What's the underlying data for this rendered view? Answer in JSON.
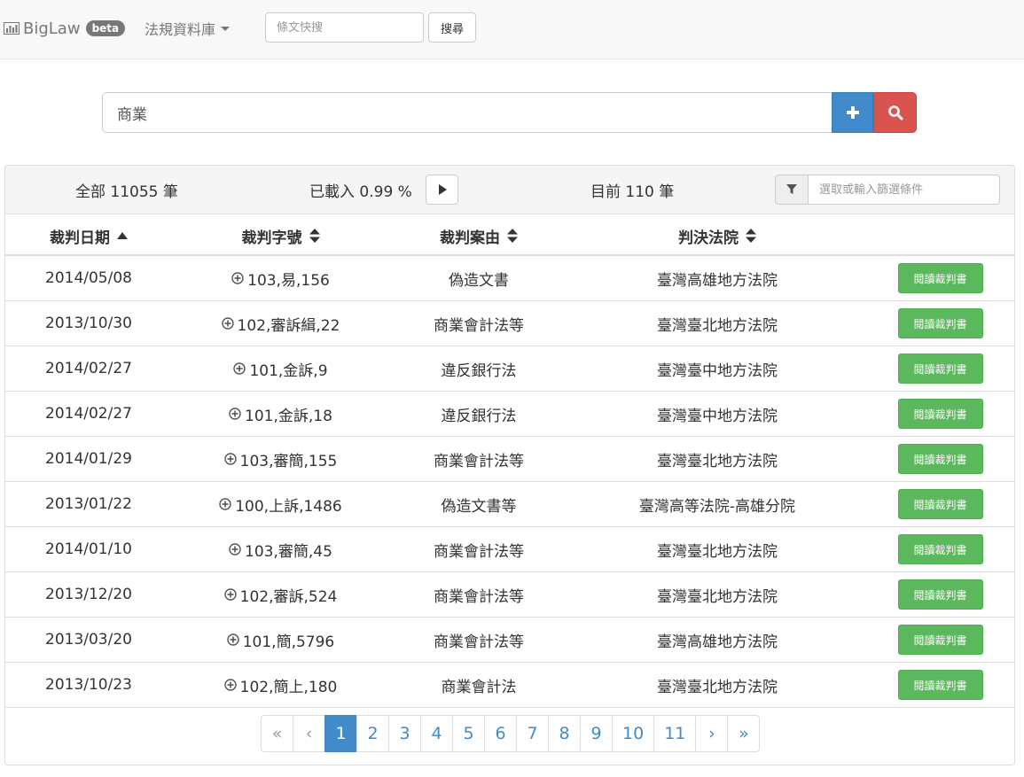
{
  "navbar": {
    "brand": "BigLaw",
    "badge": "beta",
    "dropdown_label": "法規資料庫",
    "quick_search_placeholder": "條文快搜",
    "quick_search_button": "搜尋"
  },
  "search": {
    "value": "商業"
  },
  "summary": {
    "total": "全部 11055 筆",
    "loaded": "已載入 0.99 %",
    "current": "目前 110 筆",
    "filter_placeholder": "選取或輸入篩選條件"
  },
  "table": {
    "columns": [
      {
        "label": "裁判日期",
        "sort": "asc"
      },
      {
        "label": "裁判字號",
        "sort": "both"
      },
      {
        "label": "裁判案由",
        "sort": "both"
      },
      {
        "label": "判決法院",
        "sort": "both"
      }
    ],
    "action_label": "閱讀裁判書",
    "rows": [
      {
        "date": "2014/05/08",
        "no": "103,易,156",
        "reason": "偽造文書",
        "court": "臺灣高雄地方法院"
      },
      {
        "date": "2013/10/30",
        "no": "102,審訴緝,22",
        "reason": "商業會計法等",
        "court": "臺灣臺北地方法院"
      },
      {
        "date": "2014/02/27",
        "no": "101,金訴,9",
        "reason": "違反銀行法",
        "court": "臺灣臺中地方法院"
      },
      {
        "date": "2014/02/27",
        "no": "101,金訴,18",
        "reason": "違反銀行法",
        "court": "臺灣臺中地方法院"
      },
      {
        "date": "2014/01/29",
        "no": "103,審簡,155",
        "reason": "商業會計法等",
        "court": "臺灣臺北地方法院"
      },
      {
        "date": "2013/01/22",
        "no": "100,上訴,1486",
        "reason": "偽造文書等",
        "court": "臺灣高等法院-高雄分院"
      },
      {
        "date": "2014/01/10",
        "no": "103,審簡,45",
        "reason": "商業會計法等",
        "court": "臺灣臺北地方法院"
      },
      {
        "date": "2013/12/20",
        "no": "102,審訴,524",
        "reason": "商業會計法等",
        "court": "臺灣臺北地方法院"
      },
      {
        "date": "2013/03/20",
        "no": "101,簡,5796",
        "reason": "商業會計法等",
        "court": "臺灣高雄地方法院"
      },
      {
        "date": "2013/10/23",
        "no": "102,簡上,180",
        "reason": "商業會計法",
        "court": "臺灣臺北地方法院"
      }
    ]
  },
  "pagination": {
    "first": "«",
    "prev": "‹",
    "pages": [
      "1",
      "2",
      "3",
      "4",
      "5",
      "6",
      "7",
      "8",
      "9",
      "10",
      "11"
    ],
    "active": "1",
    "next": "›",
    "last": "»"
  },
  "colors": {
    "primary": "#428bca",
    "danger": "#d9534f",
    "success": "#5cb85c"
  }
}
